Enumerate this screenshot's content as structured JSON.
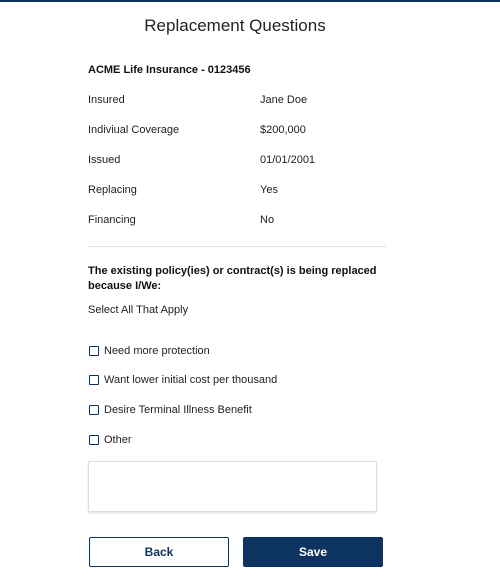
{
  "header": {
    "title": "Replacement Questions"
  },
  "policy": {
    "heading": "ACME Life Insurance - 0123456",
    "rows": [
      {
        "label": "Insured",
        "value": "Jane Doe"
      },
      {
        "label": "Indiviual Coverage",
        "value": "$200,000"
      },
      {
        "label": "Issued",
        "value": "01/01/2001"
      },
      {
        "label": "Replacing",
        "value": "Yes"
      },
      {
        "label": "Financing",
        "value": "No"
      }
    ]
  },
  "question": {
    "text": "The existing policy(ies) or contract(s) is being replaced because I/We:",
    "instruction": "Select All That Apply",
    "options": [
      {
        "label": "Need more protection",
        "checked": false
      },
      {
        "label": "Want lower initial cost per thousand",
        "checked": false
      },
      {
        "label": "Desire Terminal Illness Benefit",
        "checked": false
      },
      {
        "label": "Other",
        "checked": false
      }
    ],
    "other_text": {
      "value": "",
      "placeholder": ""
    }
  },
  "actions": {
    "back_label": "Back",
    "save_label": "Save"
  },
  "colors": {
    "primary": "#0d3461",
    "divider": "#e3e3e3",
    "text": "#222222"
  }
}
